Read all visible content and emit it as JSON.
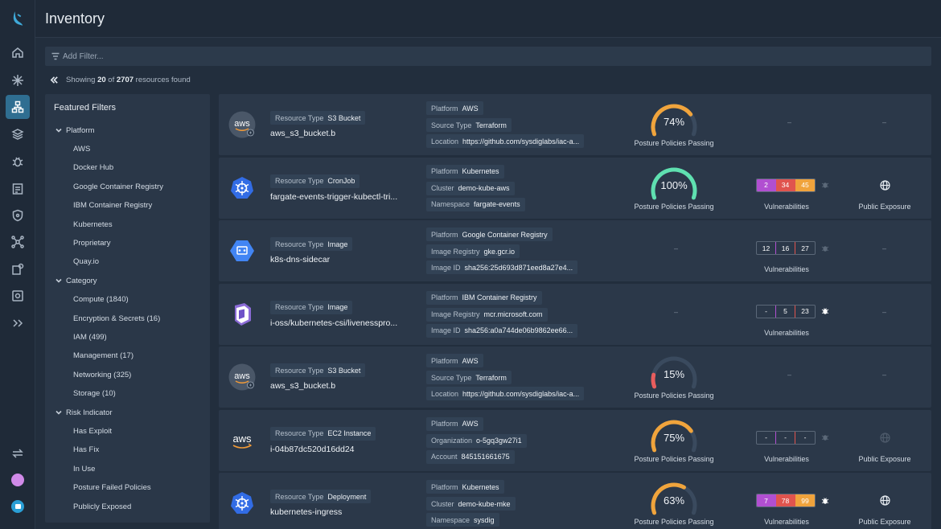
{
  "header": {
    "title": "Inventory"
  },
  "filter": {
    "placeholder": "Add Filter..."
  },
  "summary": {
    "prefix": "Showing ",
    "shown": "20",
    "middle": " of ",
    "total": "2707",
    "suffix": " resources found"
  },
  "featured": {
    "title": "Featured Filters",
    "groups": [
      {
        "label": "Platform",
        "items": [
          "AWS",
          "Docker Hub",
          "Google Container Registry",
          "IBM Container Registry",
          "Kubernetes",
          "Proprietary",
          "Quay.io"
        ]
      },
      {
        "label": "Category",
        "items": [
          "Compute (1840)",
          "Encryption & Secrets (16)",
          "IAM (499)",
          "Management (17)",
          "Networking (325)",
          "Storage (10)"
        ]
      },
      {
        "label": "Risk Indicator",
        "items": [
          "Has Exploit",
          "Has Fix",
          "In Use",
          "Posture Failed Policies",
          "Publicly Exposed"
        ]
      }
    ]
  },
  "labels": {
    "resource_type": "Resource Type",
    "posture": "Posture Policies Passing",
    "vulns": "Vulnerabilities",
    "exposure": "Public Exposure",
    "dash": "–"
  },
  "colors": {
    "accent": "#2f6e91",
    "gauge_good": "#5fe0b0",
    "gauge_mid": "#f0a43c",
    "gauge_bad": "#e85d5d",
    "gauge_track": "#3a4a5e",
    "critical": "#b14fd1",
    "high": "#e0544e",
    "medium": "#f0a33c"
  },
  "resources": [
    {
      "logo": "aws-s3-icon",
      "type": "S3 Bucket",
      "name": "aws_s3_bucket.b",
      "meta": [
        {
          "k": "Platform",
          "v": "AWS"
        },
        {
          "k": "Source Type",
          "v": "Terraform"
        },
        {
          "k": "Location",
          "v": "https://github.com/sysdiglabs/iac-a..."
        }
      ],
      "posture": 74,
      "posture_text": "74%",
      "vulns": null,
      "exposure": "none"
    },
    {
      "logo": "kubernetes-icon",
      "type": "CronJob",
      "name": "fargate-events-trigger-kubectl-tri...",
      "meta": [
        {
          "k": "Platform",
          "v": "Kubernetes"
        },
        {
          "k": "Cluster",
          "v": "demo-kube-aws"
        },
        {
          "k": "Namespace",
          "v": "fargate-events"
        }
      ],
      "posture": 100,
      "posture_text": "100%",
      "vulns": {
        "values": [
          "2",
          "34",
          "45"
        ],
        "filled": true,
        "exploit": false
      },
      "exposure": "public"
    },
    {
      "logo": "gcr-icon",
      "type": "Image",
      "name": "k8s-dns-sidecar",
      "meta": [
        {
          "k": "Platform",
          "v": "Google Container Registry"
        },
        {
          "k": "Image Registry",
          "v": "gke.gcr.io"
        },
        {
          "k": "Image ID",
          "v": "sha256:25d693d871eed8a27e4..."
        }
      ],
      "posture": null,
      "posture_text": "",
      "vulns": {
        "values": [
          "12",
          "16",
          "27"
        ],
        "filled": false,
        "exploit": false
      },
      "exposure": "none"
    },
    {
      "logo": "ibm-registry-icon",
      "type": "Image",
      "name": "i-oss/kubernetes-csi/livenesspro...",
      "meta": [
        {
          "k": "Platform",
          "v": "IBM Container Registry"
        },
        {
          "k": "Image Registry",
          "v": "mcr.microsoft.com"
        },
        {
          "k": "Image ID",
          "v": "sha256:a0a744de06b9862ee66..."
        }
      ],
      "posture": null,
      "posture_text": "",
      "vulns": {
        "values": [
          "-",
          "5",
          "23"
        ],
        "filled": false,
        "exploit": true
      },
      "exposure": "none"
    },
    {
      "logo": "aws-s3-icon",
      "type": "S3 Bucket",
      "name": "aws_s3_bucket.b",
      "meta": [
        {
          "k": "Platform",
          "v": "AWS"
        },
        {
          "k": "Source Type",
          "v": "Terraform"
        },
        {
          "k": "Location",
          "v": "https://github.com/sysdiglabs/iac-a..."
        }
      ],
      "posture": 15,
      "posture_text": "15%",
      "vulns": null,
      "exposure": "none"
    },
    {
      "logo": "aws-icon",
      "type": "EC2 Instance",
      "name": "i-04b87dc520d16dd24",
      "meta": [
        {
          "k": "Platform",
          "v": "AWS"
        },
        {
          "k": "Organization",
          "v": "o-5gq3gw27i1"
        },
        {
          "k": "Account",
          "v": "845151661675"
        }
      ],
      "posture": 75,
      "posture_text": "75%",
      "vulns": {
        "values": [
          "-",
          "-",
          "-"
        ],
        "filled": false,
        "exploit": false
      },
      "exposure": "private"
    },
    {
      "logo": "kubernetes-icon",
      "type": "Deployment",
      "name": "kubernetes-ingress",
      "meta": [
        {
          "k": "Platform",
          "v": "Kubernetes"
        },
        {
          "k": "Cluster",
          "v": "demo-kube-mke"
        },
        {
          "k": "Namespace",
          "v": "sysdig"
        }
      ],
      "posture": 63,
      "posture_text": "63%",
      "vulns": {
        "values": [
          "7",
          "78",
          "99"
        ],
        "filled": true,
        "exploit": true
      },
      "exposure": "public"
    }
  ]
}
